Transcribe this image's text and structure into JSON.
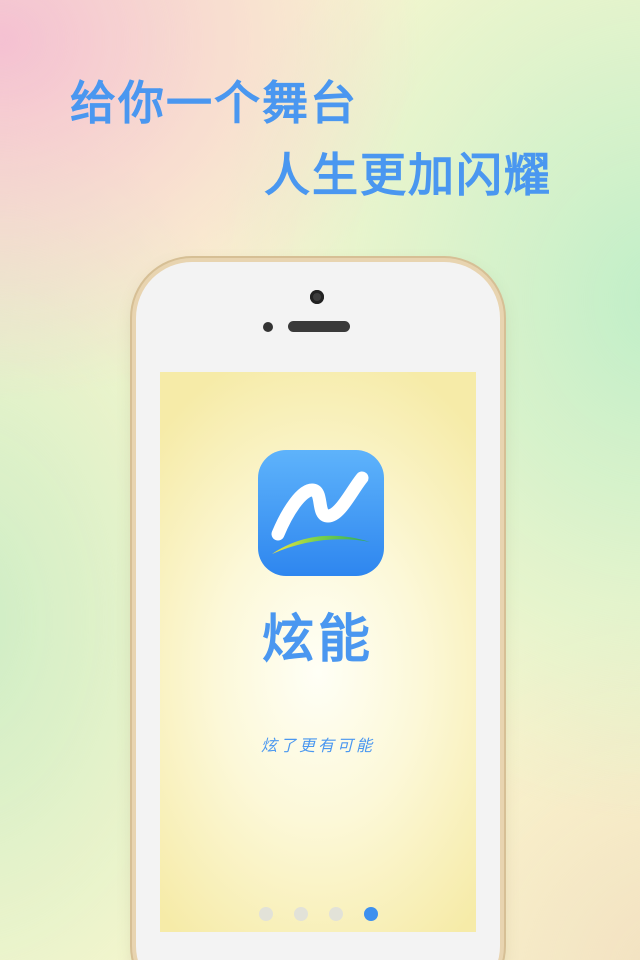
{
  "promo": {
    "headline_line1": "给你一个舞台",
    "headline_line2": "人生更加闪耀"
  },
  "splash": {
    "app_name": "炫能",
    "slogan": "炫了更有可能",
    "logo_icon": "wave-n-logo-icon"
  },
  "pager": {
    "total_pages": 4,
    "current_page": 4
  },
  "colors": {
    "accent": "#4a97f0",
    "active_dot": "#3d90ef",
    "inactive_dot": "#e2e2d8",
    "phone_frame": "#e8d4b0"
  }
}
